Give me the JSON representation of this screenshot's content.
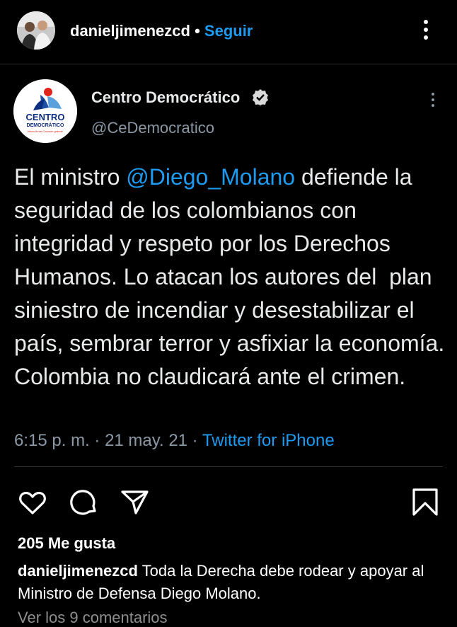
{
  "header": {
    "username": "danieljimenezcd",
    "separator": "•",
    "follow_label": "Seguir",
    "more_icon": "more-vertical-icon"
  },
  "tweet": {
    "display_name": "Centro Democrático",
    "handle": "@CeDemocratico",
    "verified_icon": "verified-badge-icon",
    "text_before": "El ministro ",
    "mention": "@Diego_Molano",
    "text_after": " defiende la seguridad de los colombianos con integridad y respeto por los Derechos Humanos. Lo atacan los autores del  plan siniestro de incendiar y desestabilizar el país, sembrar terror y asfixiar la economía. Colombia no claudicará ante el crimen.",
    "time": "6:15 p. m.",
    "sep1": " · ",
    "date": "21 may. 21",
    "sep2": " · ",
    "source": "Twitter for iPhone",
    "logo_text_1": "CENTRO",
    "logo_text_2": "DEMOCRÁTICO",
    "logo_text_3": "Mano firme Corazón grande"
  },
  "actions": {
    "like_icon": "heart-icon",
    "comment_icon": "comment-icon",
    "share_icon": "send-icon",
    "save_icon": "bookmark-icon"
  },
  "likes": "205 Me gusta",
  "caption": {
    "user": "danieljimenezcd",
    "text": " Toda la Derecha debe rodear y apoyar al Ministro de Defensa Diego Molano."
  },
  "view_comments": "Ver los 9 comentarios",
  "colors": {
    "accent": "#1d9bf0",
    "background": "#000000",
    "secondary_text": "#8b98a5"
  }
}
